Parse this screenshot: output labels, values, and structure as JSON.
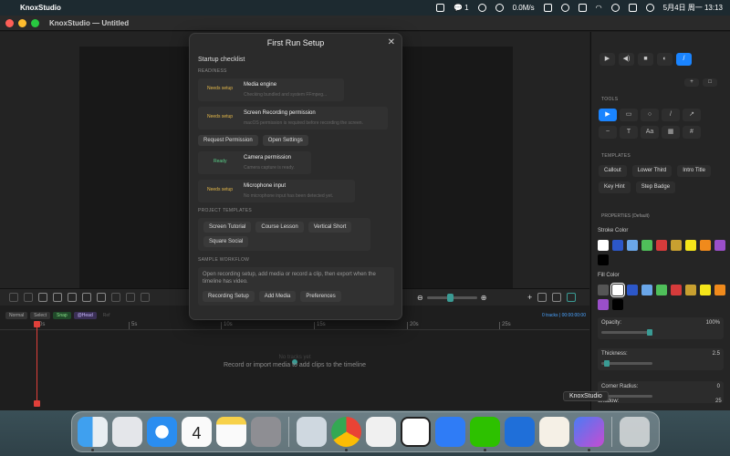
{
  "menubar": {
    "app_name": "KnoxStudio",
    "net_speed": "0.0M/s",
    "wechat_count": "1",
    "datetime": "5月4日 周一  13:13"
  },
  "window": {
    "title": "KnoxStudio — Untitled"
  },
  "timeline": {
    "modes": [
      "Normal",
      "Select",
      "Snap",
      "@Head",
      "Ref"
    ],
    "status": "0 tracks | 00:00:00:00",
    "ticks": [
      "0s",
      "5s",
      "10s",
      "15s",
      "20s",
      "25s"
    ],
    "empty_hint": "Record or import media to add clips to the timeline",
    "empty_faint": "No tracks yet",
    "zoom_level": 0.45
  },
  "dialog": {
    "title": "First Run Setup",
    "heading": "Startup checklist",
    "readiness_label": "READINESS",
    "checks": [
      {
        "status": "Needs setup",
        "name": "Media engine",
        "desc": "Checking bundled and system FFmpeg..."
      },
      {
        "status": "Needs setup",
        "name": "Screen Recording permission",
        "desc": "macOS permission is required before recording the screen."
      },
      {
        "status": "Ready",
        "name": "Camera permission",
        "desc": "Camera capture is ready."
      },
      {
        "status": "Needs setup",
        "name": "Microphone input",
        "desc": "No microphone input has been detected yet."
      }
    ],
    "perm_buttons": [
      "Request Permission",
      "Open Settings"
    ],
    "templates_label": "PROJECT TEMPLATES",
    "templates": [
      "Screen Tutorial",
      "Course Lesson",
      "Vertical Short",
      "Square Social"
    ],
    "workflow_label": "SAMPLE WORKFLOW",
    "workflow_text": "Open recording setup, add media or record a clip, then export when the timeline has video.",
    "workflow_buttons": [
      "Recording Setup",
      "Add Media",
      "Preferences"
    ]
  },
  "inspector": {
    "tools_label": "TOOLS",
    "templates_label": "TEMPLATES",
    "templates": [
      "Callout",
      "Lower Third",
      "Intro Title",
      "Key Hint",
      "Step Badge"
    ],
    "properties_label": "PROPERTIES (Default)",
    "stroke_label": "Stroke Color",
    "fill_label": "Fill Color",
    "stroke_colors": [
      "#ffffff",
      "#2c57c9",
      "#6aa6e8",
      "#4fbf5a",
      "#d63b3b",
      "#c8a030",
      "#f5e61a",
      "#f08a1c",
      "#9a4fc9",
      "#000000"
    ],
    "fill_colors": [
      "#555555",
      "#ffffff",
      "#2c57c9",
      "#6aa6e8",
      "#4fbf5a",
      "#d63b3b",
      "#c8a030",
      "#f5e61a",
      "#f08a1c",
      "#9a4fc9",
      "#000000"
    ],
    "opacity": {
      "label": "Opacity:",
      "value": "100%",
      "level": 1.0
    },
    "thickness": {
      "label": "Thickness:",
      "value": "2.5",
      "level": 0.05
    },
    "radius": {
      "label": "Corner Radius:",
      "value": "0",
      "level": 0.0
    },
    "shadow": {
      "label": "Shadow:",
      "value": "25"
    }
  },
  "dock": {
    "tooltip": "KnoxStudio",
    "calendar_day": "4"
  }
}
